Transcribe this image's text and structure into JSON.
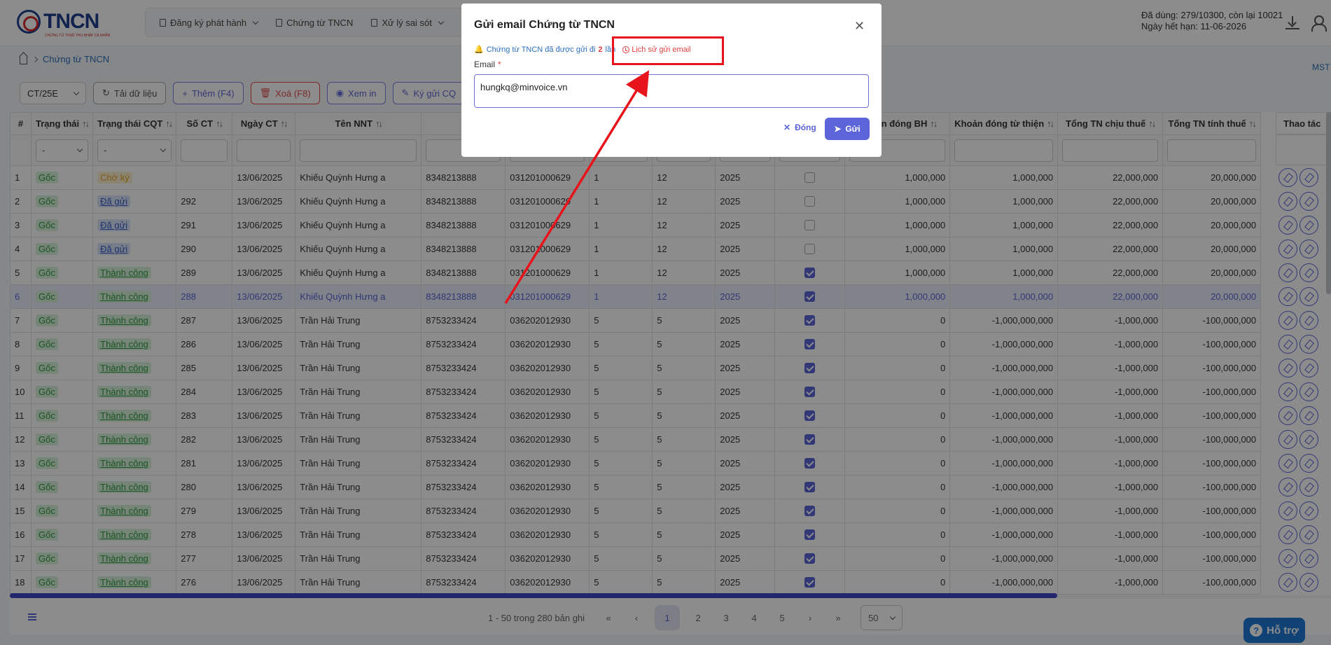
{
  "logo": {
    "text": "TNCN",
    "sub": "CHỨNG TỪ THUẾ THU NHẬP CÁ NHÂN"
  },
  "menu": {
    "items": [
      {
        "label": "Đăng ký phát hành"
      },
      {
        "label": "Chứng từ TNCN"
      },
      {
        "label": "Xử lý sai sót"
      }
    ]
  },
  "quota": {
    "line1": "Đã dùng: 279/10300, còn lại 10021",
    "line2": "Ngày hết hạn: 11-06-2026"
  },
  "breadcrumb": {
    "current": "Chứng từ TNCN"
  },
  "mst": "MST",
  "toolbar": {
    "select": "CT/25E",
    "reload": "Tải dữ liệu",
    "add": "Thêm (F4)",
    "delete": "Xoá (F8)",
    "view": "Xem in",
    "sign": "Ký gửi CQ"
  },
  "columns": [
    "#",
    "Trạng thái",
    "Trạng thái CQT",
    "Số CT",
    "Ngày CT",
    "Tên NNT",
    "",
    "",
    "",
    "",
    "",
    "",
    "Khoản đóng BH",
    "Khoản đóng từ thiện",
    "Tổng TN chịu thuế",
    "Tổng TN tính thuế"
  ],
  "actions_header": "Thao tác",
  "filter_placeholder": "-",
  "rows": [
    {
      "n": "1",
      "st": "Gốc",
      "cqt": "Chờ ký",
      "so": "",
      "ngay": "13/06/2025",
      "ten": "Khiếu Quỳnh Hưng a",
      "mst": "8348213888",
      "cccd": "031201000629",
      "k": "1",
      "th": "12",
      "nam": "2025",
      "chk": false,
      "bh": "1,000,000",
      "tt": "1,000,000",
      "cht": "22,000,000",
      "tinh": "20,000,000"
    },
    {
      "n": "2",
      "st": "Gốc",
      "cqt": "Đã gửi",
      "so": "292",
      "ngay": "13/06/2025",
      "ten": "Khiếu Quỳnh Hưng a",
      "mst": "8348213888",
      "cccd": "031201000629",
      "k": "1",
      "th": "12",
      "nam": "2025",
      "chk": false,
      "bh": "1,000,000",
      "tt": "1,000,000",
      "cht": "22,000,000",
      "tinh": "20,000,000"
    },
    {
      "n": "3",
      "st": "Gốc",
      "cqt": "Đã gửi",
      "so": "291",
      "ngay": "13/06/2025",
      "ten": "Khiếu Quỳnh Hưng a",
      "mst": "8348213888",
      "cccd": "031201000629",
      "k": "1",
      "th": "12",
      "nam": "2025",
      "chk": false,
      "bh": "1,000,000",
      "tt": "1,000,000",
      "cht": "22,000,000",
      "tinh": "20,000,000"
    },
    {
      "n": "4",
      "st": "Gốc",
      "cqt": "Đã gửi",
      "so": "290",
      "ngay": "13/06/2025",
      "ten": "Khiếu Quỳnh Hưng a",
      "mst": "8348213888",
      "cccd": "031201000629",
      "k": "1",
      "th": "12",
      "nam": "2025",
      "chk": false,
      "bh": "1,000,000",
      "tt": "1,000,000",
      "cht": "22,000,000",
      "tinh": "20,000,000"
    },
    {
      "n": "5",
      "st": "Gốc",
      "cqt": "Thành công",
      "so": "289",
      "ngay": "13/06/2025",
      "ten": "Khiếu Quỳnh Hưng a",
      "mst": "8348213888",
      "cccd": "031201000629",
      "k": "1",
      "th": "12",
      "nam": "2025",
      "chk": true,
      "bh": "1,000,000",
      "tt": "1,000,000",
      "cht": "22,000,000",
      "tinh": "20,000,000"
    },
    {
      "n": "6",
      "st": "Gốc",
      "cqt": "Thành công",
      "so": "288",
      "ngay": "13/06/2025",
      "ten": "Khiếu Quỳnh Hưng a",
      "mst": "8348213888",
      "cccd": "031201000629",
      "k": "1",
      "th": "12",
      "nam": "2025",
      "chk": true,
      "bh": "1,000,000",
      "tt": "1,000,000",
      "cht": "22,000,000",
      "tinh": "20,000,000",
      "hl": true
    },
    {
      "n": "7",
      "st": "Gốc",
      "cqt": "Thành công",
      "so": "287",
      "ngay": "13/06/2025",
      "ten": "Trần Hải Trung",
      "mst": "8753233424",
      "cccd": "036202012930",
      "k": "5",
      "th": "5",
      "nam": "2025",
      "chk": true,
      "bh": "0",
      "tt": "-1,000,000,000",
      "cht": "-1,000,000",
      "tinh": "-100,000,000"
    },
    {
      "n": "8",
      "st": "Gốc",
      "cqt": "Thành công",
      "so": "286",
      "ngay": "13/06/2025",
      "ten": "Trần Hải Trung",
      "mst": "8753233424",
      "cccd": "036202012930",
      "k": "5",
      "th": "5",
      "nam": "2025",
      "chk": true,
      "bh": "0",
      "tt": "-1,000,000,000",
      "cht": "-1,000,000",
      "tinh": "-100,000,000"
    },
    {
      "n": "9",
      "st": "Gốc",
      "cqt": "Thành công",
      "so": "285",
      "ngay": "13/06/2025",
      "ten": "Trần Hải Trung",
      "mst": "8753233424",
      "cccd": "036202012930",
      "k": "5",
      "th": "5",
      "nam": "2025",
      "chk": true,
      "bh": "0",
      "tt": "-1,000,000,000",
      "cht": "-1,000,000",
      "tinh": "-100,000,000"
    },
    {
      "n": "10",
      "st": "Gốc",
      "cqt": "Thành công",
      "so": "284",
      "ngay": "13/06/2025",
      "ten": "Trần Hải Trung",
      "mst": "8753233424",
      "cccd": "036202012930",
      "k": "5",
      "th": "5",
      "nam": "2025",
      "chk": true,
      "bh": "0",
      "tt": "-1,000,000,000",
      "cht": "-1,000,000",
      "tinh": "-100,000,000"
    },
    {
      "n": "11",
      "st": "Gốc",
      "cqt": "Thành công",
      "so": "283",
      "ngay": "13/06/2025",
      "ten": "Trần Hải Trung",
      "mst": "8753233424",
      "cccd": "036202012930",
      "k": "5",
      "th": "5",
      "nam": "2025",
      "chk": true,
      "bh": "0",
      "tt": "-1,000,000,000",
      "cht": "-1,000,000",
      "tinh": "-100,000,000"
    },
    {
      "n": "12",
      "st": "Gốc",
      "cqt": "Thành công",
      "so": "282",
      "ngay": "13/06/2025",
      "ten": "Trần Hải Trung",
      "mst": "8753233424",
      "cccd": "036202012930",
      "k": "5",
      "th": "5",
      "nam": "2025",
      "chk": true,
      "bh": "0",
      "tt": "-1,000,000,000",
      "cht": "-1,000,000",
      "tinh": "-100,000,000"
    },
    {
      "n": "13",
      "st": "Gốc",
      "cqt": "Thành công",
      "so": "281",
      "ngay": "13/06/2025",
      "ten": "Trần Hải Trung",
      "mst": "8753233424",
      "cccd": "036202012930",
      "k": "5",
      "th": "5",
      "nam": "2025",
      "chk": true,
      "bh": "0",
      "tt": "-1,000,000,000",
      "cht": "-1,000,000",
      "tinh": "-100,000,000"
    },
    {
      "n": "14",
      "st": "Gốc",
      "cqt": "Thành công",
      "so": "280",
      "ngay": "13/06/2025",
      "ten": "Trần Hải Trung",
      "mst": "8753233424",
      "cccd": "036202012930",
      "k": "5",
      "th": "5",
      "nam": "2025",
      "chk": true,
      "bh": "0",
      "tt": "-1,000,000,000",
      "cht": "-1,000,000",
      "tinh": "-100,000,000"
    },
    {
      "n": "15",
      "st": "Gốc",
      "cqt": "Thành công",
      "so": "279",
      "ngay": "13/06/2025",
      "ten": "Trần Hải Trung",
      "mst": "8753233424",
      "cccd": "036202012930",
      "k": "5",
      "th": "5",
      "nam": "2025",
      "chk": true,
      "bh": "0",
      "tt": "-1,000,000,000",
      "cht": "-1,000,000",
      "tinh": "-100,000,000"
    },
    {
      "n": "16",
      "st": "Gốc",
      "cqt": "Thành công",
      "so": "278",
      "ngay": "13/06/2025",
      "ten": "Trần Hải Trung",
      "mst": "8753233424",
      "cccd": "036202012930",
      "k": "5",
      "th": "5",
      "nam": "2025",
      "chk": true,
      "bh": "0",
      "tt": "-1,000,000,000",
      "cht": "-1,000,000",
      "tinh": "-100,000,000"
    },
    {
      "n": "17",
      "st": "Gốc",
      "cqt": "Thành công",
      "so": "277",
      "ngay": "13/06/2025",
      "ten": "Trần Hải Trung",
      "mst": "8753233424",
      "cccd": "036202012930",
      "k": "5",
      "th": "5",
      "nam": "2025",
      "chk": true,
      "bh": "0",
      "tt": "-1,000,000,000",
      "cht": "-1,000,000",
      "tinh": "-100,000,000"
    },
    {
      "n": "18",
      "st": "Gốc",
      "cqt": "Thành công",
      "so": "276",
      "ngay": "13/06/2025",
      "ten": "Trần Hải Trung",
      "mst": "8753233424",
      "cccd": "036202012930",
      "k": "5",
      "th": "5",
      "nam": "2025",
      "chk": true,
      "bh": "0",
      "tt": "-1,000,000,000",
      "cht": "-1,000,000",
      "tinh": "-100,000,000"
    }
  ],
  "pagination": {
    "summary": "1 - 50 trong 280 bản ghi",
    "pages": [
      "1",
      "2",
      "3",
      "4",
      "5"
    ],
    "page_size": "50"
  },
  "help": {
    "label": "Hỗ trợ"
  },
  "modal": {
    "title": "Gửi email Chứng từ TNCN",
    "info_prefix": "Chứng từ TNCN đã được gửi đi",
    "info_count": "2",
    "info_suffix": "lần",
    "history": "Lịch sử gửi email",
    "email_label": "Email",
    "required": "*",
    "email_value": "hungkq@minvoice.vn",
    "cancel": "Đóng",
    "send": "Gửi"
  },
  "colors": {
    "accent": "#5b64d8",
    "annotation": "#e8141c",
    "success": "#2e9b3f"
  }
}
